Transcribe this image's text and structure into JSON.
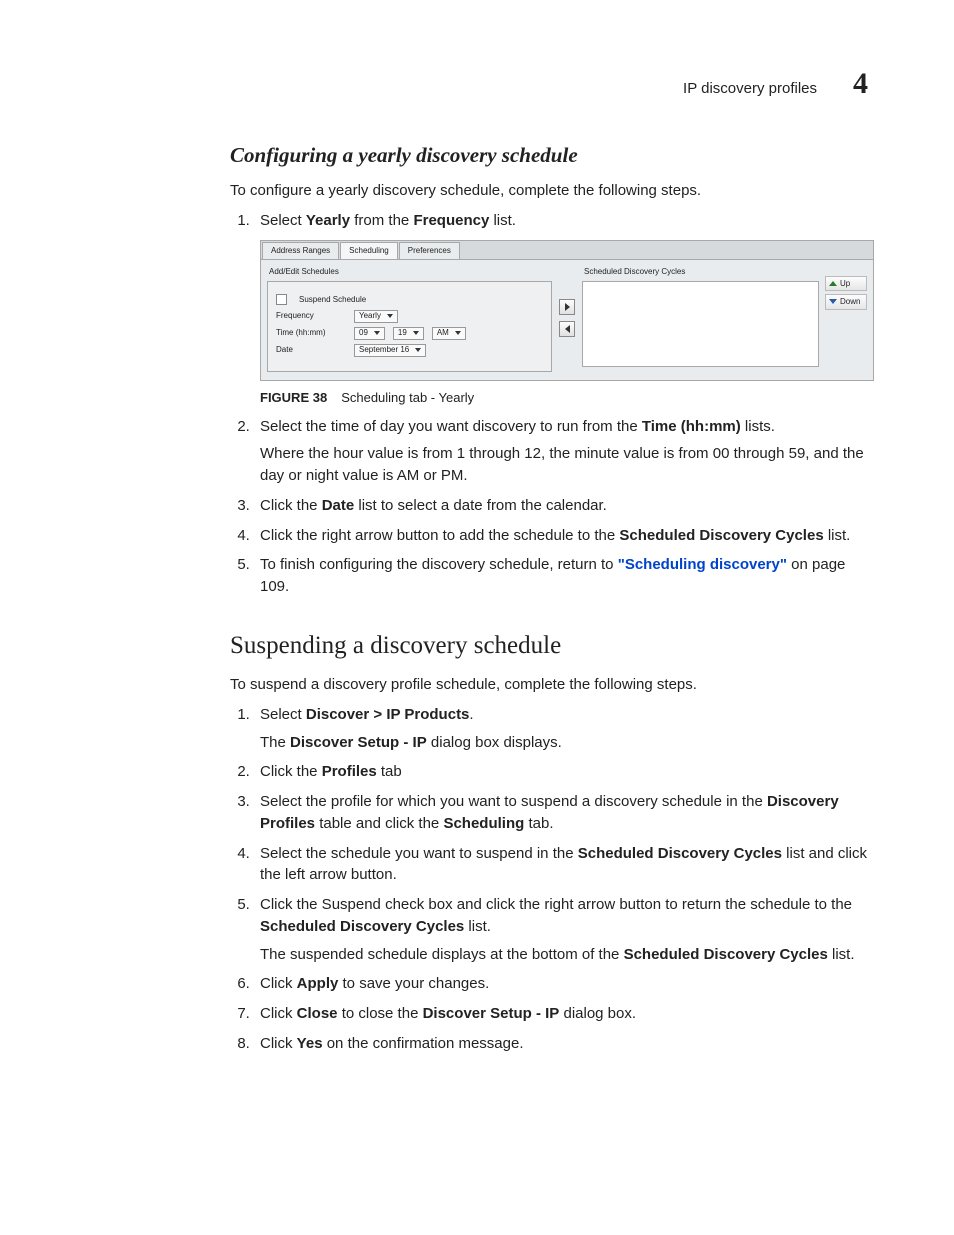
{
  "header": {
    "section": "IP discovery profiles",
    "chapter": "4"
  },
  "h3": "Configuring a yearly discovery schedule",
  "intro1": "To configure a yearly discovery schedule, complete the following steps.",
  "list1": {
    "i1a": "Select ",
    "i1b": "Yearly",
    "i1c": " from the ",
    "i1d": "Frequency",
    "i1e": " list.",
    "i2a": "Select the time of day you want discovery to run from the ",
    "i2b": "Time (hh:mm)",
    "i2c": " lists.",
    "i2p": "Where the hour value is from 1 through 12, the minute value is from 00 through 59, and the day or night value is AM or PM.",
    "i3a": "Click the ",
    "i3b": "Date",
    "i3c": " list to select a date from the calendar.",
    "i4a": "Click the right arrow button to add the schedule to the ",
    "i4b": "Scheduled Discovery Cycles",
    "i4c": " list.",
    "i5a": "To finish configuring the discovery schedule, return to ",
    "i5b": "\"Scheduling discovery\"",
    "i5c": " on page 109."
  },
  "figure": {
    "num": "FIGURE 38",
    "caption": "Scheduling tab - Yearly",
    "tabs": {
      "t1": "Address Ranges",
      "t2": "Scheduling",
      "t3": "Preferences"
    },
    "leftLabel": "Add/Edit Schedules",
    "suspend": "Suspend Schedule",
    "freqLabel": "Frequency",
    "freqValue": "Yearly",
    "timeLabel": "Time (hh:mm)",
    "timeHH": "09",
    "timeMM": "19",
    "timeAP": "AM",
    "dateLabel": "Date",
    "dateValue": "September 16",
    "rightLabel": "Scheduled Discovery Cycles",
    "up": "Up",
    "down": "Down"
  },
  "h2": "Suspending a discovery schedule",
  "intro2": "To suspend a discovery profile schedule, complete the following steps.",
  "list2": {
    "i1a": "Select ",
    "i1b": "Discover > IP Products",
    "i1c": ".",
    "i1p1": "The ",
    "i1p2": "Discover Setup - IP",
    "i1p3": " dialog box displays.",
    "i2a": "Click the ",
    "i2b": "Profiles",
    "i2c": " tab",
    "i3a": "Select the profile for which you want to suspend a discovery schedule in the ",
    "i3b": "Discovery Profiles",
    "i3c": " table and click the ",
    "i3d": "Scheduling",
    "i3e": " tab.",
    "i4a": "Select the schedule you want to suspend in the ",
    "i4b": "Scheduled Discovery Cycles",
    "i4c": " list and click the left arrow button.",
    "i5a": "Click the Suspend check box and click the right arrow button to return the schedule to the ",
    "i5b": "Scheduled Discovery Cycles",
    "i5c": " list.",
    "i5p1": "The suspended schedule displays at the bottom of the ",
    "i5p2": "Scheduled Discovery Cycles",
    "i5p3": " list.",
    "i6a": "Click ",
    "i6b": "Apply",
    "i6c": " to save your changes.",
    "i7a": "Click ",
    "i7b": "Close",
    "i7c": " to close the ",
    "i7d": "Discover Setup - IP",
    "i7e": " dialog box.",
    "i8a": "Click ",
    "i8b": "Yes",
    "i8c": " on the confirmation message."
  }
}
